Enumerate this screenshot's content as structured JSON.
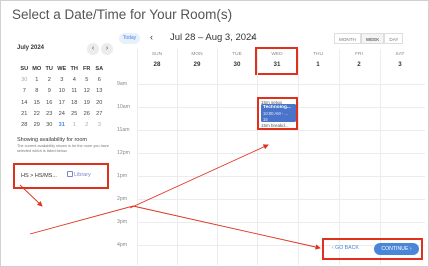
{
  "page": {
    "title": "Select a Date/Time for Your Room(s)"
  },
  "mini_calendar": {
    "month_label": "July 2024",
    "prev_glyph": "‹",
    "next_glyph": "›",
    "weekdays": [
      "SU",
      "MO",
      "TU",
      "WE",
      "TH",
      "FR",
      "SA"
    ],
    "weeks": [
      [
        "30",
        "1",
        "2",
        "3",
        "4",
        "5",
        "6"
      ],
      [
        "7",
        "8",
        "9",
        "10",
        "11",
        "12",
        "13"
      ],
      [
        "14",
        "15",
        "16",
        "17",
        "18",
        "19",
        "20"
      ],
      [
        "21",
        "22",
        "23",
        "24",
        "25",
        "26",
        "27"
      ],
      [
        "28",
        "29",
        "30",
        "31",
        "1",
        "2",
        "3"
      ]
    ]
  },
  "availability": {
    "title": "Showing availability for room",
    "description": "The current availability shown is for the room you have selected which is listed below.",
    "room_name": "HS > HS/MS...",
    "room_tag": "Library"
  },
  "calendar": {
    "today_label": "Today",
    "range_label": "Jul 28 – Aug 3, 2024",
    "prev_glyph": "‹",
    "next_glyph": "›",
    "views": [
      "MONTH",
      "WEEK",
      "DAY"
    ],
    "active_view": "WEEK",
    "days": [
      {
        "name": "SUN",
        "num": "28"
      },
      {
        "name": "MON",
        "num": "29"
      },
      {
        "name": "TUE",
        "num": "30"
      },
      {
        "name": "WED",
        "num": "31"
      },
      {
        "name": "THU",
        "num": "1"
      },
      {
        "name": "FRI",
        "num": "2"
      },
      {
        "name": "SAT",
        "num": "3"
      }
    ],
    "times": [
      "9am",
      "10am",
      "11am",
      "12pm",
      "1pm",
      "2pm",
      "3pm",
      "4pm"
    ]
  },
  "event": {
    "setup_label": "15m setup",
    "title": "Technolog...",
    "time": "10:00 AM - ...",
    "count": "15",
    "teardown_label": "15m breakd...",
    "color": "#4a74c9"
  },
  "footer": {
    "go_back_label": "‹ GO BACK",
    "continue_label": "CONTINUE ›"
  },
  "colors": {
    "accent": "#4a86d8",
    "highlight": "#e0301e"
  }
}
